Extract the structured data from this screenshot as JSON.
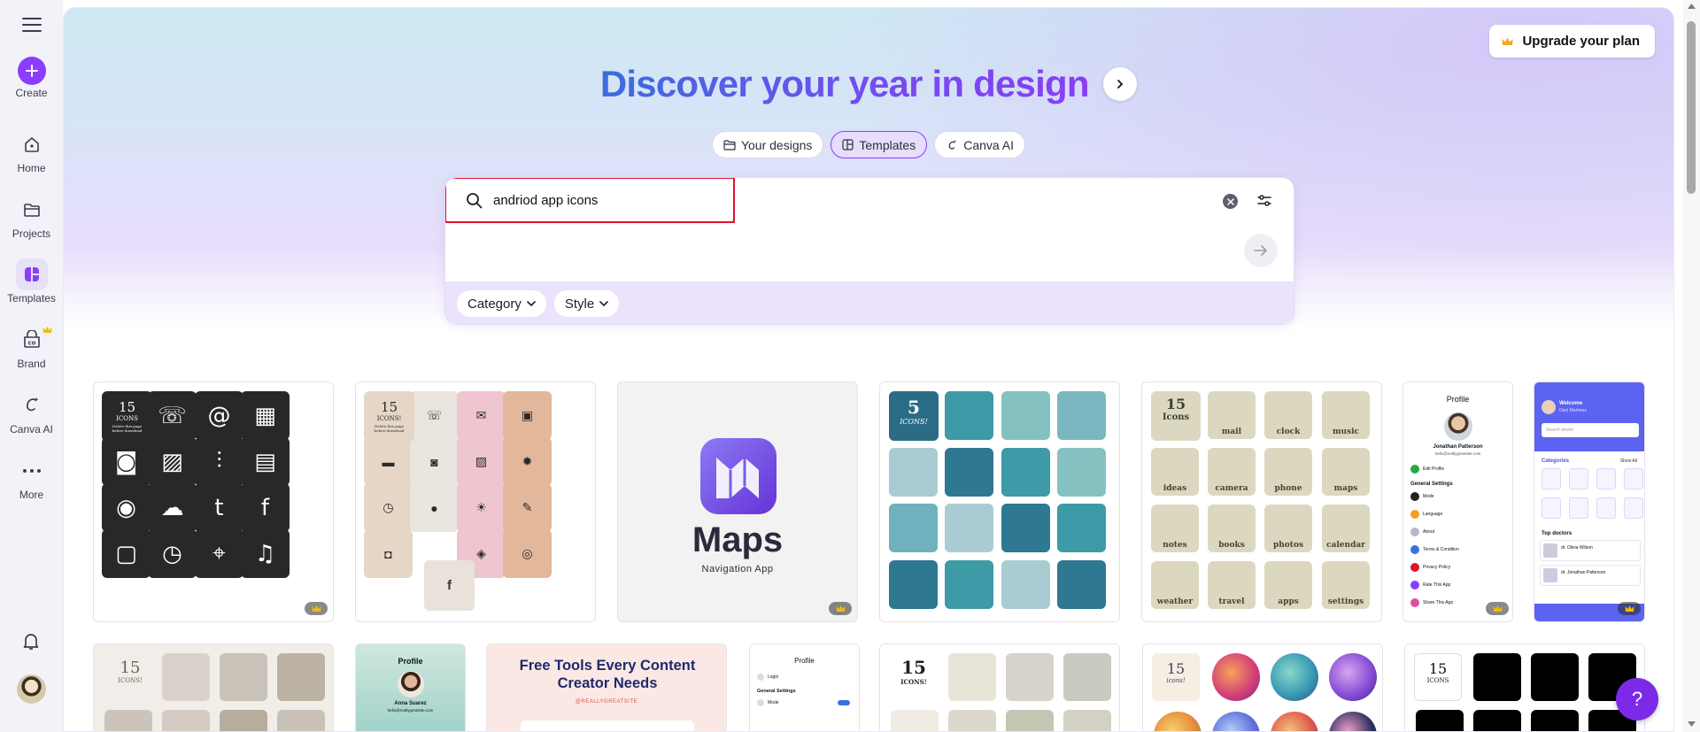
{
  "sidebar": {
    "items": [
      {
        "label": "Create"
      },
      {
        "label": "Home"
      },
      {
        "label": "Projects"
      },
      {
        "label": "Templates"
      },
      {
        "label": "Brand"
      },
      {
        "label": "Canva AI"
      },
      {
        "label": "More"
      }
    ]
  },
  "header": {
    "upgrade_label": "Upgrade your plan",
    "headline": "Discover your year in design"
  },
  "tabs": [
    {
      "label": "Your designs"
    },
    {
      "label": "Templates"
    },
    {
      "label": "Canva AI"
    }
  ],
  "search": {
    "value": "andriod app icons",
    "filters": [
      {
        "label": "Category"
      },
      {
        "label": "Style"
      }
    ]
  },
  "results": {
    "card1": {
      "count_line1": "15",
      "count_line2": "ICONS",
      "tagline": "Delete this page before download"
    },
    "card2": {
      "count_line1": "15",
      "count_line2": "ICONS!",
      "tagline": "Delete this page before download",
      "f_glyph": "f"
    },
    "card3": {
      "title": "Maps",
      "subtitle": "Navigation App"
    },
    "card4": {
      "count_line1": "5",
      "count_line2": "ICONS!"
    },
    "card5": {
      "count_line1": "15",
      "count_line2": "Icons",
      "labels": [
        "mail",
        "clock",
        "music",
        "ideas",
        "camera",
        "phone",
        "maps",
        "notes",
        "books",
        "photos",
        "calendar",
        "weather",
        "travel",
        "apps",
        "settings"
      ]
    },
    "card6": {
      "header": "Profile",
      "name": "Jonathan Patterson",
      "email": "hello@reallygreatsite.com",
      "edit": "Edit Profile",
      "section": "General Settings",
      "rows": [
        "Mode",
        "Language",
        "About",
        "Terms & Condition",
        "Privacy Policy",
        "Rate This App",
        "Share This App"
      ]
    },
    "card7": {
      "welcome": "Welcome",
      "name": "Dani Martinez",
      "search_placeholder": "Search doctor",
      "categories_title": "Categories",
      "show_all": "Show All",
      "top_doctors": "Top doctors",
      "doc1": "dr. Olivia Wilson",
      "doc2": "dr. Jonathan Patterson"
    },
    "row2_card3": {
      "headline": "Free Tools Every Content Creator Needs",
      "handle": "@REALLYGREATSITE"
    },
    "row2_card4": {
      "header": "Profile",
      "row1": "Login",
      "section": "General Settings",
      "row2": "Mode"
    },
    "row2_card2": {
      "header": "Profile",
      "name": "Anna Suarez",
      "email": "hello@reallygreatsite.com"
    },
    "row2_card5": {
      "count_line1": "15",
      "count_line2": "ICONS!"
    },
    "row2_card1": {
      "count_line1": "15",
      "count_line2": "ICONS!"
    },
    "row2_card6": {
      "count_line1": "15",
      "count_line2": "icons!"
    },
    "row2_card7": {
      "count_line1": "15",
      "count_line2": "ICONS"
    }
  },
  "help_label": "?",
  "colors": {
    "accent": "#8b3dff",
    "highlight_border": "#e0142b",
    "teal_dark": "#2f7892",
    "teal_mid": "#3d9aa7",
    "teal_light": "#86c1c2"
  }
}
